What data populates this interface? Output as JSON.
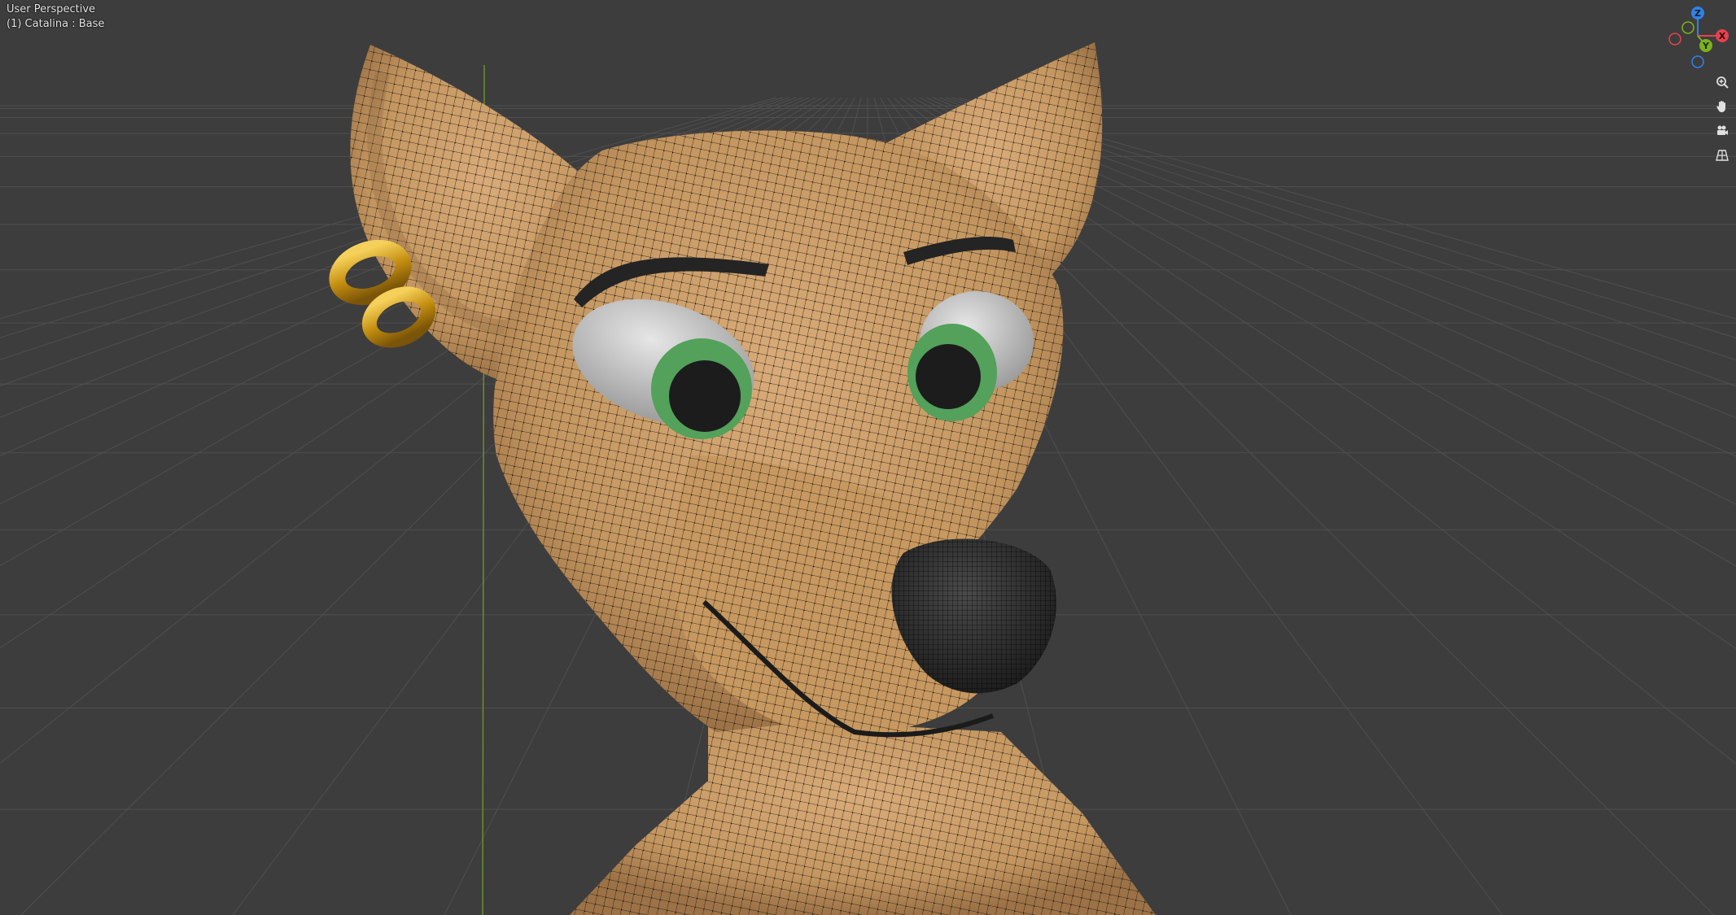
{
  "viewport": {
    "view_name": "User Perspective",
    "object_name": "(1) Catalina : Base"
  },
  "navigation_gizmo": {
    "axes": [
      {
        "label": "Z",
        "color": "#2f83e6"
      },
      {
        "label": "Y",
        "color": "#7bb21e"
      },
      {
        "label": "X",
        "color": "#e5424f"
      }
    ]
  },
  "nav_buttons": [
    {
      "name": "zoom-button",
      "icon": "zoom-icon"
    },
    {
      "name": "pan-button",
      "icon": "hand-icon"
    },
    {
      "name": "camera-view-button",
      "icon": "camera-icon"
    },
    {
      "name": "perspective-toggle-button",
      "icon": "grid-icon"
    }
  ],
  "colors": {
    "background": "#3d3d3d",
    "grid_line": "#4f4f4f",
    "y_axis_line": "#6a8f2e",
    "fur": "#c99b68",
    "wireframe": "#111111",
    "earring": "#d4a21a",
    "iris": "#53a15a",
    "nose": "#2b2b2b"
  }
}
